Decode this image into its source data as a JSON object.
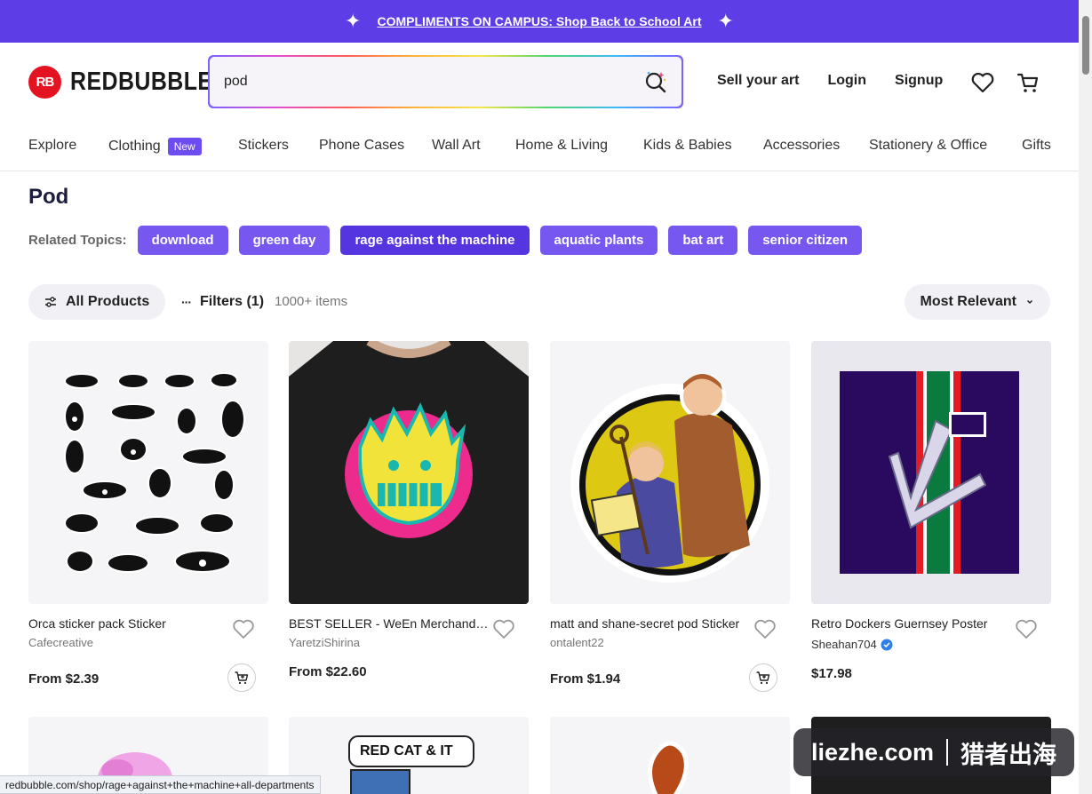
{
  "promo": {
    "text": "COMPLIMENTS ON CAMPUS: Shop Back to School Art"
  },
  "logo": {
    "badge": "RB",
    "text": "REDBUBBLE"
  },
  "search": {
    "value": "pod"
  },
  "header_links": {
    "sell": "Sell your art",
    "login": "Login",
    "signup": "Signup"
  },
  "categories": [
    {
      "label": "Explore"
    },
    {
      "label": "Clothing",
      "badge": "New"
    },
    {
      "label": "Stickers"
    },
    {
      "label": "Phone Cases"
    },
    {
      "label": "Wall Art"
    },
    {
      "label": "Home & Living"
    },
    {
      "label": "Kids & Babies"
    },
    {
      "label": "Accessories"
    },
    {
      "label": "Stationery & Office"
    },
    {
      "label": "Gifts"
    }
  ],
  "page_title": "Pod",
  "related": {
    "label": "Related Topics:",
    "topics": [
      "download",
      "green day",
      "rage against the machine",
      "aquatic plants",
      "bat art",
      "senior citizen"
    ]
  },
  "toolbar": {
    "all_products": "All Products",
    "filters": "Filters (1)",
    "count": "1000+ items",
    "sort": "Most Relevant"
  },
  "products": [
    {
      "title": "Orca sticker pack Sticker",
      "artist": "Cafecreative",
      "price": "From $2.39"
    },
    {
      "title": "BEST SELLER - WeEn Merchandise Essential T-Shirt",
      "artist": "YaretziShirina",
      "price": "From $22.60"
    },
    {
      "title": "matt and shane-secret pod Sticker",
      "artist": "ontalent22",
      "price": "From $1.94"
    },
    {
      "title": "Retro Dockers Guernsey Poster",
      "artist": "Sheahan704",
      "price": "$17.98"
    }
  ],
  "row2": {
    "sticker_text": "RED CAT & IT"
  },
  "status_bar": "redbubble.com/shop/rage+against+the+machine+all-departments",
  "watermark": {
    "left": "liezhe.com",
    "right": "猎者出海"
  },
  "colors": {
    "brand_purple": "#5d3ee6",
    "chip_purple": "#7657f0",
    "logo_red": "#e41321"
  }
}
